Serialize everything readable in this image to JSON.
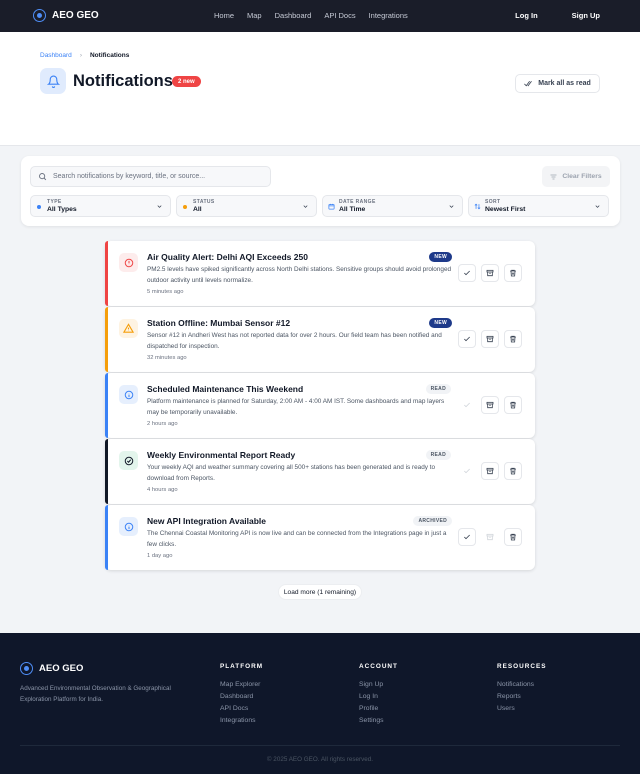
{
  "nav": {
    "brand": "AEO GEO",
    "links": [
      "Home",
      "Map",
      "Dashboard",
      "API Docs",
      "Integrations"
    ],
    "login": "Log In",
    "signup": "Sign Up"
  },
  "breadcrumb": {
    "parent": "Dashboard",
    "separator": "›",
    "current": "Notifications"
  },
  "page": {
    "title": "Notifications",
    "new_badge": "2 new",
    "mark_all": "Mark all as read"
  },
  "filters": {
    "search_placeholder": "Search notifications by keyword, title, or source...",
    "clear": "Clear Filters",
    "type": {
      "label": "TYPE",
      "value": "All Types"
    },
    "status": {
      "label": "STATUS",
      "value": "All"
    },
    "date": {
      "label": "DATE RANGE",
      "value": "All Time"
    },
    "sort": {
      "label": "SORT",
      "value": "Newest First"
    }
  },
  "notifications": [
    {
      "title": "Air Quality Alert: Delhi AQI Exceeds 250",
      "body": "PM2.5 levels have spiked significantly across North Delhi stations. Sensitive groups should avoid prolonged outdoor activity until levels normalize.",
      "time": "5 minutes ago",
      "status": "NEW",
      "icon": "alert-circle-icon",
      "color": "#ef4444"
    },
    {
      "title": "Station Offline: Mumbai Sensor #12",
      "body": "Sensor #12 in Andheri West has not reported data for over 2 hours. Our field team has been notified and dispatched for inspection.",
      "time": "32 minutes ago",
      "status": "NEW",
      "icon": "warning-triangle-icon",
      "color": "#f59e0b"
    },
    {
      "title": "Scheduled Maintenance This Weekend",
      "body": "Platform maintenance is planned for Saturday, 2:00 AM - 4:00 AM IST. Some dashboards and map layers may be temporarily unavailable.",
      "time": "2 hours ago",
      "status": "READ",
      "icon": "info-circle-icon",
      "color": "#3b82f6"
    },
    {
      "title": "Weekly Environmental Report Ready",
      "body": "Your weekly AQI and weather summary covering all 500+ stations has been generated and is ready to download from Reports.",
      "time": "4 hours ago",
      "status": "READ",
      "icon": "check-circle-icon",
      "color": "#111827"
    },
    {
      "title": "New API Integration Available",
      "body": "The Chennai Coastal Monitoring API is now live and can be connected from the Integrations page in just a few clicks.",
      "time": "1 day ago",
      "status": "ARCHIVED",
      "icon": "info-circle-icon",
      "color": "#3b82f6"
    }
  ],
  "load_more": "Load more (1 remaining)",
  "footer": {
    "brand": "AEO GEO",
    "desc": "Advanced Environmental Observation & Geographical Exploration Platform for India.",
    "platform": {
      "title": "PLATFORM",
      "links": [
        "Map Explorer",
        "Dashboard",
        "API Docs",
        "Integrations"
      ]
    },
    "account": {
      "title": "ACCOUNT",
      "links": [
        "Sign Up",
        "Log In",
        "Profile",
        "Settings"
      ]
    },
    "resources": {
      "title": "RESOURCES",
      "links": [
        "Notifications",
        "Reports",
        "Users"
      ]
    },
    "copyright": "© 2025 AEO GEO. All rights reserved."
  }
}
